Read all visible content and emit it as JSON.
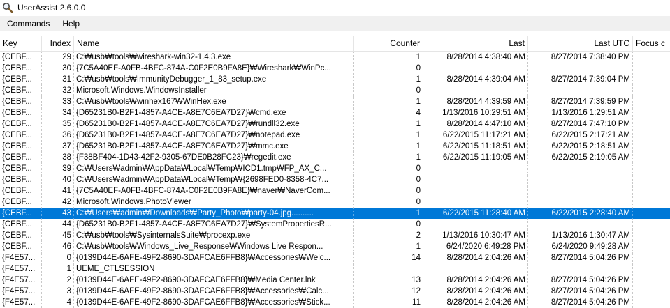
{
  "window": {
    "title": "UserAssist 2.6.0.0"
  },
  "menu": [
    {
      "label": "Commands"
    },
    {
      "label": "Help"
    }
  ],
  "columns": {
    "key": "Key",
    "index": "Index",
    "name": "Name",
    "counter": "Counter",
    "last": "Last",
    "last_utc": "Last UTC",
    "focus": "Focus c"
  },
  "selected_row_index": 43,
  "rows": [
    {
      "key": "{CEBF...",
      "index": "29",
      "name": "C:₩usb₩tools₩wireshark-win32-1.4.3.exe",
      "counter": "1",
      "last": "8/28/2014 4:38:40 AM",
      "last_utc": "8/27/2014 7:38:40 PM"
    },
    {
      "key": "{CEBF...",
      "index": "30",
      "name": "{7C5A40EF-A0FB-4BFC-874A-C0F2E0B9FA8E}₩Wireshark₩WinPc...",
      "counter": "0",
      "last": "",
      "last_utc": ""
    },
    {
      "key": "{CEBF...",
      "index": "31",
      "name": "C:₩usb₩tools₩ImmunityDebugger_1_83_setup.exe",
      "counter": "1",
      "last": "8/28/2014 4:39:04 AM",
      "last_utc": "8/27/2014 7:39:04 PM"
    },
    {
      "key": "{CEBF...",
      "index": "32",
      "name": "Microsoft.Windows.WindowsInstaller",
      "counter": "0",
      "last": "",
      "last_utc": ""
    },
    {
      "key": "{CEBF...",
      "index": "33",
      "name": "C:₩usb₩tools₩winhex167₩WinHex.exe",
      "counter": "1",
      "last": "8/28/2014 4:39:59 AM",
      "last_utc": "8/27/2014 7:39:59 PM"
    },
    {
      "key": "{CEBF...",
      "index": "34",
      "name": "{D65231B0-B2F1-4857-A4CE-A8E7C6EA7D27}₩cmd.exe",
      "counter": "4",
      "last": "1/13/2016 10:29:51 AM",
      "last_utc": "1/13/2016 1:29:51 AM"
    },
    {
      "key": "{CEBF...",
      "index": "35",
      "name": "{D65231B0-B2F1-4857-A4CE-A8E7C6EA7D27}₩rundll32.exe",
      "counter": "1",
      "last": "8/28/2014 4:47:10 AM",
      "last_utc": "8/27/2014 7:47:10 PM"
    },
    {
      "key": "{CEBF...",
      "index": "36",
      "name": "{D65231B0-B2F1-4857-A4CE-A8E7C6EA7D27}₩notepad.exe",
      "counter": "1",
      "last": "6/22/2015 11:17:21 AM",
      "last_utc": "6/22/2015 2:17:21 AM"
    },
    {
      "key": "{CEBF...",
      "index": "37",
      "name": "{D65231B0-B2F1-4857-A4CE-A8E7C6EA7D27}₩mmc.exe",
      "counter": "1",
      "last": "6/22/2015 11:18:51 AM",
      "last_utc": "6/22/2015 2:18:51 AM"
    },
    {
      "key": "{CEBF...",
      "index": "38",
      "name": "{F38BF404-1D43-42F2-9305-67DE0B28FC23}₩regedit.exe",
      "counter": "1",
      "last": "6/22/2015 11:19:05 AM",
      "last_utc": "6/22/2015 2:19:05 AM"
    },
    {
      "key": "{CEBF...",
      "index": "39",
      "name": "C:₩Users₩admin₩AppData₩Local₩Temp₩ICD1.tmp₩FP_AX_C...",
      "counter": "0",
      "last": "",
      "last_utc": ""
    },
    {
      "key": "{CEBF...",
      "index": "40",
      "name": "C:₩Users₩admin₩AppData₩Local₩Temp₩{2698FED0-8358-4C7...",
      "counter": "0",
      "last": "",
      "last_utc": ""
    },
    {
      "key": "{CEBF...",
      "index": "41",
      "name": "{7C5A40EF-A0FB-4BFC-874A-C0F2E0B9FA8E}₩naver₩NaverCom...",
      "counter": "0",
      "last": "",
      "last_utc": ""
    },
    {
      "key": "{CEBF...",
      "index": "42",
      "name": "Microsoft.Windows.PhotoViewer",
      "counter": "0",
      "last": "",
      "last_utc": ""
    },
    {
      "key": "{CEBF...",
      "index": "43",
      "name": "C:₩Users₩admin₩Downloads₩Party_Photo₩party-04.jpg..........",
      "counter": "1",
      "last": "6/22/2015 11:28:40 AM",
      "last_utc": "6/22/2015 2:28:40 AM"
    },
    {
      "key": "{CEBF...",
      "index": "44",
      "name": "{D65231B0-B2F1-4857-A4CE-A8E7C6EA7D27}₩SystemPropertiesR...",
      "counter": "0",
      "last": "",
      "last_utc": ""
    },
    {
      "key": "{CEBF...",
      "index": "45",
      "name": "C:₩usb₩tools₩SysinternalsSuite₩procexp.exe",
      "counter": "2",
      "last": "1/13/2016 10:30:47 AM",
      "last_utc": "1/13/2016 1:30:47 AM"
    },
    {
      "key": "{CEBF...",
      "index": "46",
      "name": "C:₩usb₩tools₩Windows_Live_Response₩Windows Live Respon...",
      "counter": "1",
      "last": "6/24/2020 6:49:28 PM",
      "last_utc": "6/24/2020 9:49:28 AM"
    },
    {
      "key": "{F4E57...",
      "index": "0",
      "name": "{0139D44E-6AFE-49F2-8690-3DAFCAE6FFB8}₩Accessories₩Welc...",
      "counter": "14",
      "last": "8/28/2014 2:04:26 AM",
      "last_utc": "8/27/2014 5:04:26 PM"
    },
    {
      "key": "{F4E57...",
      "index": "1",
      "name": "UEME_CTLSESSION",
      "counter": "",
      "last": "",
      "last_utc": ""
    },
    {
      "key": "{F4E57...",
      "index": "2",
      "name": "{0139D44E-6AFE-49F2-8690-3DAFCAE6FFB8}₩Media Center.lnk",
      "counter": "13",
      "last": "8/28/2014 2:04:26 AM",
      "last_utc": "8/27/2014 5:04:26 PM"
    },
    {
      "key": "{F4E57...",
      "index": "3",
      "name": "{0139D44E-6AFE-49F2-8690-3DAFCAE6FFB8}₩Accessories₩Calc...",
      "counter": "12",
      "last": "8/28/2014 2:04:26 AM",
      "last_utc": "8/27/2014 5:04:26 PM"
    },
    {
      "key": "{F4E57...",
      "index": "4",
      "name": "{0139D44E-6AFE-49F2-8690-3DAFCAE6FFB8}₩Accessories₩Stick...",
      "counter": "11",
      "last": "8/28/2014 2:04:26 AM",
      "last_utc": "8/27/2014 5:04:26 PM"
    }
  ]
}
